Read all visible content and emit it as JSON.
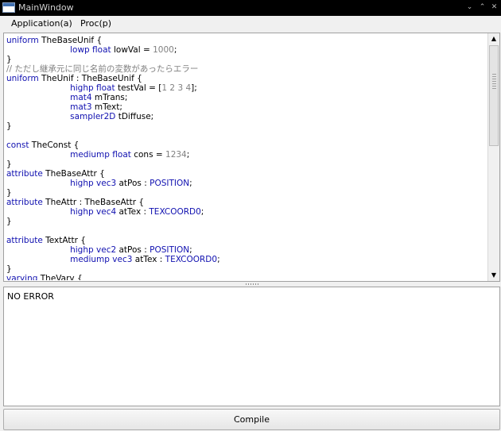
{
  "window": {
    "title": "MainWindow",
    "minimize_glyph": "⌄",
    "maximize_glyph": "⌃",
    "close_glyph": "✕"
  },
  "menu": {
    "items": [
      {
        "label": "Application(a)"
      },
      {
        "label": "Proc(p)"
      }
    ]
  },
  "editor": {
    "lines": [
      [
        {
          "t": "uniform",
          "c": "kw"
        },
        {
          "t": " TheBaseUnif {",
          "c": "id"
        }
      ],
      [
        {
          "t": "\t\t\tlowp",
          "c": "kw"
        },
        {
          "t": " ",
          "c": "id"
        },
        {
          "t": "float",
          "c": "kw"
        },
        {
          "t": " lowVal = ",
          "c": "id"
        },
        {
          "t": "1000",
          "c": "num"
        },
        {
          "t": ";",
          "c": "id"
        }
      ],
      [
        {
          "t": "}",
          "c": "id"
        }
      ],
      [
        {
          "t": "// ただし継承元に同じ名前の変数があったらエラー",
          "c": "cm"
        }
      ],
      [
        {
          "t": "uniform",
          "c": "kw"
        },
        {
          "t": " TheUnif : TheBaseUnif {",
          "c": "id"
        }
      ],
      [
        {
          "t": "\t\t\thighp",
          "c": "kw"
        },
        {
          "t": " ",
          "c": "id"
        },
        {
          "t": "float",
          "c": "kw"
        },
        {
          "t": " testVal = [",
          "c": "id"
        },
        {
          "t": "1 2 3 4",
          "c": "num"
        },
        {
          "t": "];",
          "c": "id"
        }
      ],
      [
        {
          "t": "\t\t\tmat4",
          "c": "kw"
        },
        {
          "t": " mTrans;",
          "c": "id"
        }
      ],
      [
        {
          "t": "\t\t\tmat3",
          "c": "kw"
        },
        {
          "t": " mText;",
          "c": "id"
        }
      ],
      [
        {
          "t": "\t\t\tsampler2D",
          "c": "kw"
        },
        {
          "t": " tDiffuse;",
          "c": "id"
        }
      ],
      [
        {
          "t": "}",
          "c": "id"
        }
      ],
      [
        {
          "t": "",
          "c": "id"
        }
      ],
      [
        {
          "t": "const",
          "c": "kw"
        },
        {
          "t": " TheConst {",
          "c": "id"
        }
      ],
      [
        {
          "t": "\t\t\tmediump",
          "c": "kw"
        },
        {
          "t": " ",
          "c": "id"
        },
        {
          "t": "float",
          "c": "kw"
        },
        {
          "t": " cons = ",
          "c": "id"
        },
        {
          "t": "1234",
          "c": "num"
        },
        {
          "t": ";",
          "c": "id"
        }
      ],
      [
        {
          "t": "}",
          "c": "id"
        }
      ],
      [
        {
          "t": "attribute",
          "c": "kw"
        },
        {
          "t": " TheBaseAttr {",
          "c": "id"
        }
      ],
      [
        {
          "t": "\t\t\thighp",
          "c": "kw"
        },
        {
          "t": " ",
          "c": "id"
        },
        {
          "t": "vec3",
          "c": "kw"
        },
        {
          "t": " atPos : ",
          "c": "id"
        },
        {
          "t": "POSITION",
          "c": "kw"
        },
        {
          "t": ";",
          "c": "id"
        }
      ],
      [
        {
          "t": "}",
          "c": "id"
        }
      ],
      [
        {
          "t": "attribute",
          "c": "kw"
        },
        {
          "t": " TheAttr : TheBaseAttr {",
          "c": "id"
        }
      ],
      [
        {
          "t": "\t\t\thighp",
          "c": "kw"
        },
        {
          "t": " ",
          "c": "id"
        },
        {
          "t": "vec4",
          "c": "kw"
        },
        {
          "t": " atTex : ",
          "c": "id"
        },
        {
          "t": "TEXCOORD0",
          "c": "kw"
        },
        {
          "t": ";",
          "c": "id"
        }
      ],
      [
        {
          "t": "}",
          "c": "id"
        }
      ],
      [
        {
          "t": "",
          "c": "id"
        }
      ],
      [
        {
          "t": "attribute",
          "c": "kw"
        },
        {
          "t": " TextAttr {",
          "c": "id"
        }
      ],
      [
        {
          "t": "\t\t\thighp",
          "c": "kw"
        },
        {
          "t": " ",
          "c": "id"
        },
        {
          "t": "vec2",
          "c": "kw"
        },
        {
          "t": " atPos : ",
          "c": "id"
        },
        {
          "t": "POSITION",
          "c": "kw"
        },
        {
          "t": ";",
          "c": "id"
        }
      ],
      [
        {
          "t": "\t\t\tmediump",
          "c": "kw"
        },
        {
          "t": " ",
          "c": "id"
        },
        {
          "t": "vec3",
          "c": "kw"
        },
        {
          "t": " atTex : ",
          "c": "id"
        },
        {
          "t": "TEXCOORD0",
          "c": "kw"
        },
        {
          "t": ";",
          "c": "id"
        }
      ],
      [
        {
          "t": "}",
          "c": "id"
        }
      ],
      [
        {
          "t": "varying",
          "c": "kw"
        },
        {
          "t": " TheVary {",
          "c": "id"
        }
      ]
    ]
  },
  "scrollbar": {
    "up_glyph": "▲",
    "down_glyph": "▼"
  },
  "output": {
    "text": "NO ERROR"
  },
  "compile_button": {
    "label": "Compile"
  }
}
